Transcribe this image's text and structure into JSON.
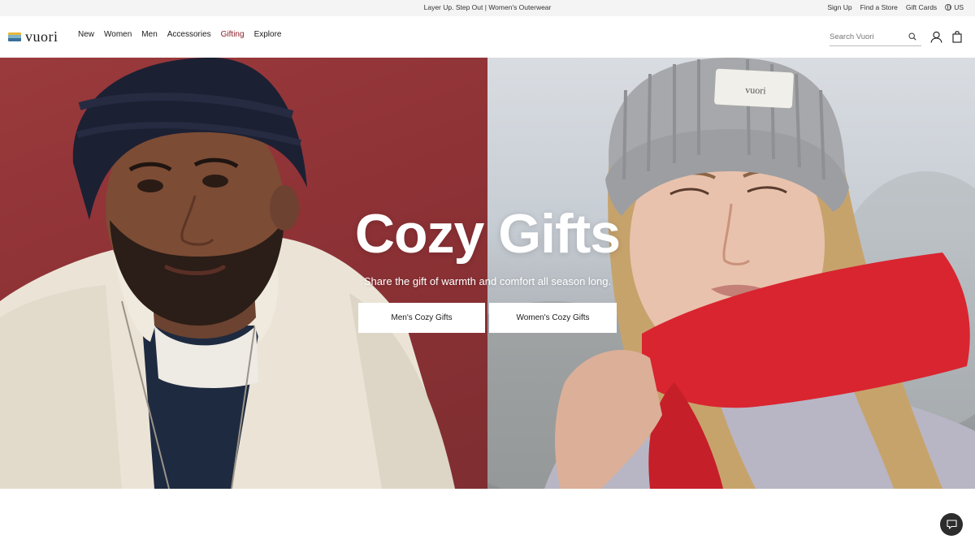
{
  "announcement": {
    "text": "Layer Up. Step Out | Women's Outerwear"
  },
  "utility_links": [
    {
      "label": "Sign Up"
    },
    {
      "label": "Find a Store"
    },
    {
      "label": "Gift Cards"
    },
    {
      "label": "US",
      "icon": "globe-icon"
    }
  ],
  "header": {
    "logo_text": "vuori",
    "logo_colors": [
      "#e8b63a",
      "#7fb3c8",
      "#3a6f9a"
    ],
    "nav": [
      {
        "label": "New"
      },
      {
        "label": "Women"
      },
      {
        "label": "Men"
      },
      {
        "label": "Accessories"
      },
      {
        "label": "Gifting",
        "color": "#8b1f2a"
      },
      {
        "label": "Explore"
      }
    ],
    "search_placeholder": "Search Vuori",
    "icons": [
      "search-icon",
      "account-icon",
      "shopping-bag-icon"
    ]
  },
  "hero": {
    "title": "Cozy Gifts",
    "subtitle": "Share the gift of warmth and comfort all season long.",
    "buttons": [
      {
        "label": "Men's Cozy Gifts"
      },
      {
        "label": "Women's Cozy Gifts"
      }
    ],
    "left_panel_color": "#8e3236",
    "right_panel_color": "#c6ccd3",
    "beanie_label": "vuori"
  },
  "chat": {
    "icon": "chat-icon"
  }
}
